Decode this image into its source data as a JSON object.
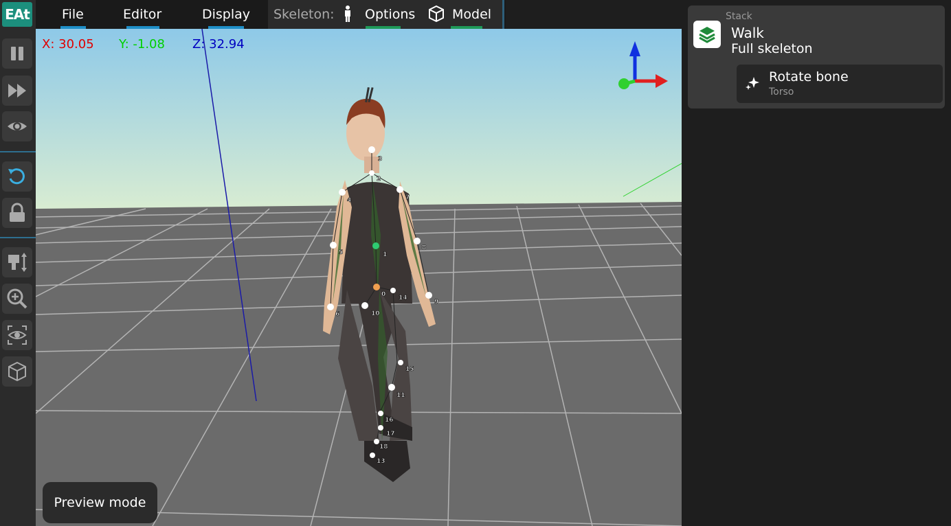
{
  "app": {
    "logo_text": "EAt"
  },
  "menubar": {
    "file": "File",
    "editor": "Editor",
    "display": "Display",
    "skeleton_label": "Skeleton:",
    "options": "Options",
    "model": "Model"
  },
  "toolbar": {
    "icons": [
      "pause-icon",
      "fast-forward-icon",
      "eye-icon",
      "undo-icon",
      "lock-icon",
      "resize-icon",
      "zoom-in-icon",
      "focus-eye-icon",
      "cube-icon"
    ]
  },
  "viewport": {
    "coords": {
      "x": "X: 30.05",
      "y": "Y: -1.08",
      "z": "Z: 32.94"
    },
    "preview_mode": "Preview mode",
    "bone_labels": [
      "0",
      "1",
      "2",
      "3",
      "4",
      "5",
      "6",
      "7",
      "8",
      "9",
      "10",
      "11",
      "14",
      "15",
      "16",
      "17",
      "18",
      "13"
    ]
  },
  "right_panel": {
    "stack_header": "Stack",
    "stack_title": "Walk",
    "stack_subtitle": "Full skeleton",
    "operation_title": "Rotate bone",
    "operation_subtitle": "Torso"
  },
  "colors": {
    "accent": "#1c8f7d",
    "menu_underline_blue": "#1f8fc8",
    "menu_underline_green": "#1f9a5a",
    "coord_x": "#e00000",
    "coord_y": "#00d000",
    "coord_z": "#0000c0"
  }
}
